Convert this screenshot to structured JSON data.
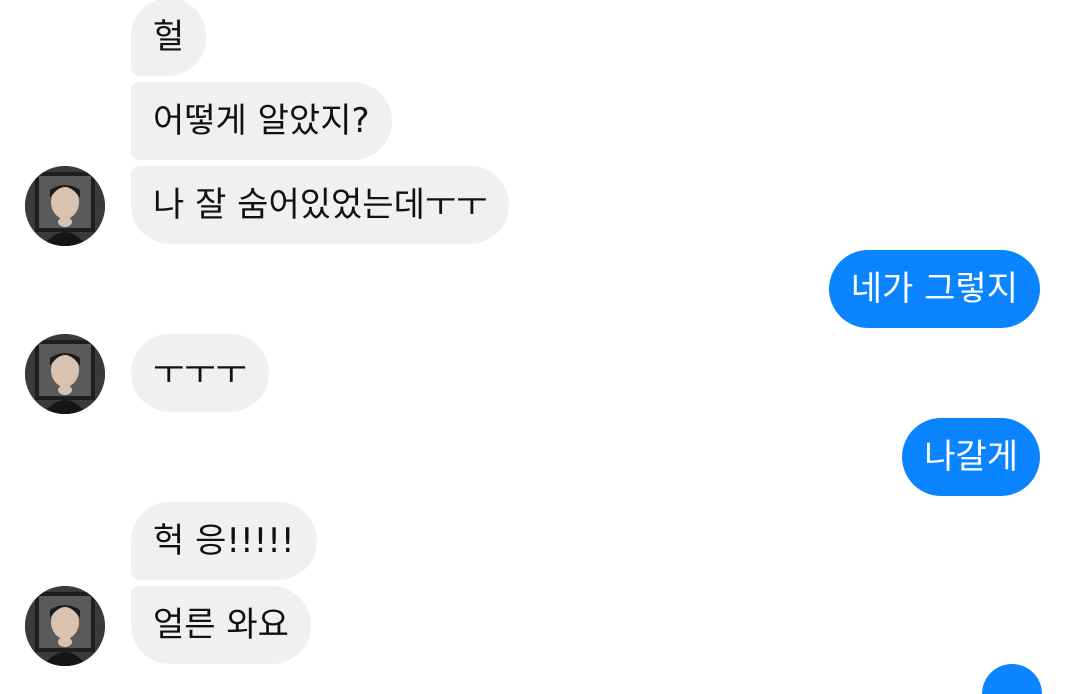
{
  "conversation": {
    "messages": [
      {
        "sender": "them",
        "text": "헐"
      },
      {
        "sender": "them",
        "text": "어떻게 알았지?"
      },
      {
        "sender": "them",
        "text": "나 잘 숨어있었는데ㅜㅜ"
      },
      {
        "sender": "me",
        "text": "네가 그렇지"
      },
      {
        "sender": "them",
        "text": "ㅜㅜㅜ"
      },
      {
        "sender": "me",
        "text": "나갈게"
      },
      {
        "sender": "them",
        "text": "헉 응!!!!!"
      },
      {
        "sender": "them",
        "text": "얼른 와요"
      }
    ]
  },
  "colors": {
    "incoming_bubble": "#f0f0f0",
    "outgoing_bubble": "#0a84ff",
    "incoming_text": "#111111",
    "outgoing_text": "#ffffff"
  },
  "icons": {
    "contact_avatar": "profile-photo"
  }
}
